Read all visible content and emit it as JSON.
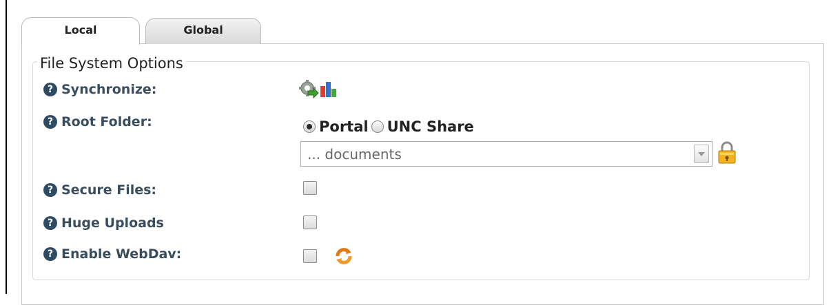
{
  "tabs": [
    {
      "label": "Local",
      "active": true
    },
    {
      "label": "Global",
      "active": false
    }
  ],
  "fieldset": {
    "legend": "File System Options"
  },
  "rows": {
    "synchronize": {
      "label": "Synchronize:",
      "icons": [
        "sync-gear-icon",
        "bar-chart-icon"
      ]
    },
    "root_folder": {
      "label": "Root Folder:",
      "options": [
        {
          "label": "Portal",
          "selected": true
        },
        {
          "label": "UNC Share",
          "selected": false
        }
      ],
      "select_value": "... documents",
      "icons": [
        "lock-icon"
      ]
    },
    "secure_files": {
      "label": "Secure Files:",
      "checked": false
    },
    "huge_uploads": {
      "label": "Huge Uploads",
      "checked": false
    },
    "enable_webdav": {
      "label": "Enable WebDav:",
      "checked": false,
      "icons": [
        "refresh-icon"
      ]
    }
  },
  "colors": {
    "label": "#3a4d5e",
    "help_icon": "#2f4b63",
    "border": "#cfd8dd"
  }
}
